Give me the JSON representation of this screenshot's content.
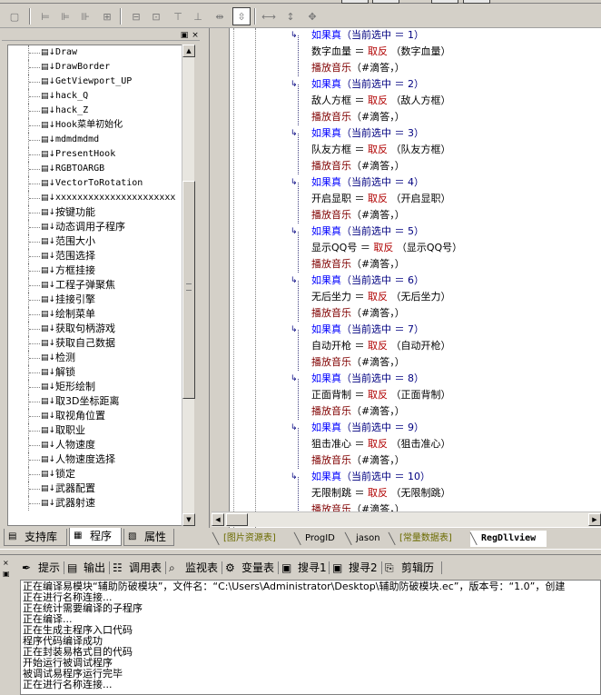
{
  "toolbar": {
    "icons": [
      "page-icon",
      "align-left-icon",
      "align-center-icon",
      "align-right-icon",
      "grid-icon",
      "center-h-icon",
      "center-v-icon",
      "top-icon",
      "bottom-icon",
      "spacing-h-icon",
      "spacing-v-icon",
      "width-icon",
      "height-icon",
      "move-icon"
    ]
  },
  "tree": {
    "items": [
      {
        "label": "Draw",
        "mono": true
      },
      {
        "label": "DrawBorder",
        "mono": true
      },
      {
        "label": "GetViewport_UP",
        "mono": true
      },
      {
        "label": "hack_Q",
        "mono": true
      },
      {
        "label": "hack_Z",
        "mono": true
      },
      {
        "label": "Hook菜单初始化",
        "mono": true
      },
      {
        "label": "mdmdmdmd",
        "mono": true
      },
      {
        "label": "PresentHook",
        "mono": true
      },
      {
        "label": "RGBTOARGB",
        "mono": true
      },
      {
        "label": "VectorToRotation",
        "mono": true
      },
      {
        "label": "xxxxxxxxxxxxxxxxxxxxxx",
        "mono": true
      },
      {
        "label": "按键功能",
        "mono": false
      },
      {
        "label": "动态调用子程序",
        "mono": false
      },
      {
        "label": "范围大小",
        "mono": false
      },
      {
        "label": "范围选择",
        "mono": false
      },
      {
        "label": "方框挂接",
        "mono": false
      },
      {
        "label": "工程子弹聚焦",
        "mono": false
      },
      {
        "label": "挂接引擎",
        "mono": false
      },
      {
        "label": "绘制菜单",
        "mono": false
      },
      {
        "label": "获取句柄游戏",
        "mono": false
      },
      {
        "label": "获取自己数据",
        "mono": false
      },
      {
        "label": "检测",
        "mono": false
      },
      {
        "label": "解锁",
        "mono": false
      },
      {
        "label": "矩形绘制",
        "mono": false
      },
      {
        "label": "取3D坐标距离",
        "mono": false
      },
      {
        "label": "取视角位置",
        "mono": false
      },
      {
        "label": "取职业",
        "mono": false
      },
      {
        "label": "人物速度",
        "mono": false
      },
      {
        "label": "人物速度选择",
        "mono": false
      },
      {
        "label": "锁定",
        "mono": false
      },
      {
        "label": "武器配置",
        "mono": false
      },
      {
        "label": "武器射速",
        "mono": false
      }
    ]
  },
  "left_tabs": [
    {
      "label": "支持库",
      "icon": "library-icon"
    },
    {
      "label": "程序",
      "icon": "program-icon"
    },
    {
      "label": "属性",
      "icon": "properties-icon"
    }
  ],
  "code": {
    "blocks": [
      {
        "n": "1",
        "var": "数字血量",
        "arg": "数字血量"
      },
      {
        "n": "2",
        "var": "敌人方框",
        "arg": "敌人方框"
      },
      {
        "n": "3",
        "var": "队友方框",
        "arg": "队友方框"
      },
      {
        "n": "4",
        "var": "开启显职",
        "arg": "开启显职"
      },
      {
        "n": "5",
        "var": "显示QQ号",
        "arg": "显示QQ号"
      },
      {
        "n": "6",
        "var": "无后坐力",
        "arg": "无后坐力"
      },
      {
        "n": "7",
        "var": "自动开枪",
        "arg": "自动开枪"
      },
      {
        "n": "8",
        "var": "正面背制",
        "arg": "正面背制"
      },
      {
        "n": "9",
        "var": "狙击准心",
        "arg": "狙击准心"
      },
      {
        "n": "10",
        "var": "无限制跳",
        "arg": "无限制跳"
      }
    ],
    "if_kw": "如果真",
    "if_cond": "（当前选中 ＝ ",
    "if_close": "）",
    "eq": " ＝ ",
    "negate": "取反",
    "play": "播放音乐",
    "play_args": "（#滴答，）"
  },
  "code_tabs": [
    {
      "label": "[图片资源表]",
      "style": "green"
    },
    {
      "label": "ProgID",
      "style": "normal"
    },
    {
      "label": "jason",
      "style": "normal"
    },
    {
      "label": "[常量数据表]",
      "style": "green"
    },
    {
      "label": "RegDllview",
      "style": "active"
    }
  ],
  "output_tabs": [
    {
      "label": "提示",
      "icon": "bulb-icon"
    },
    {
      "label": "输出",
      "icon": "output-icon"
    },
    {
      "label": "调用表",
      "icon": "call-table-icon"
    },
    {
      "label": "监视表",
      "icon": "watch-icon"
    },
    {
      "label": "变量表",
      "icon": "variable-icon"
    },
    {
      "label": "搜寻1",
      "icon": "search1-icon"
    },
    {
      "label": "搜寻2",
      "icon": "search2-icon"
    },
    {
      "label": "剪辑历史",
      "icon": "clipboard-icon"
    }
  ],
  "output_lines": [
    "正在编译易模块“辅助防破模块”，文件名：“C:\\Users\\Administrator\\Desktop\\辅助防破模块.ec”，版本号：“1.0”，创建",
    "正在进行名称连接...",
    "正在统计需要编译的子程序",
    "正在编译...",
    "正在生成主程序入口代码",
    "程序代码编译成功",
    "正在封装易格式目的代码",
    "开始运行被调试程序",
    "被调试易程序运行完毕",
    "正在进行名称连接..."
  ]
}
